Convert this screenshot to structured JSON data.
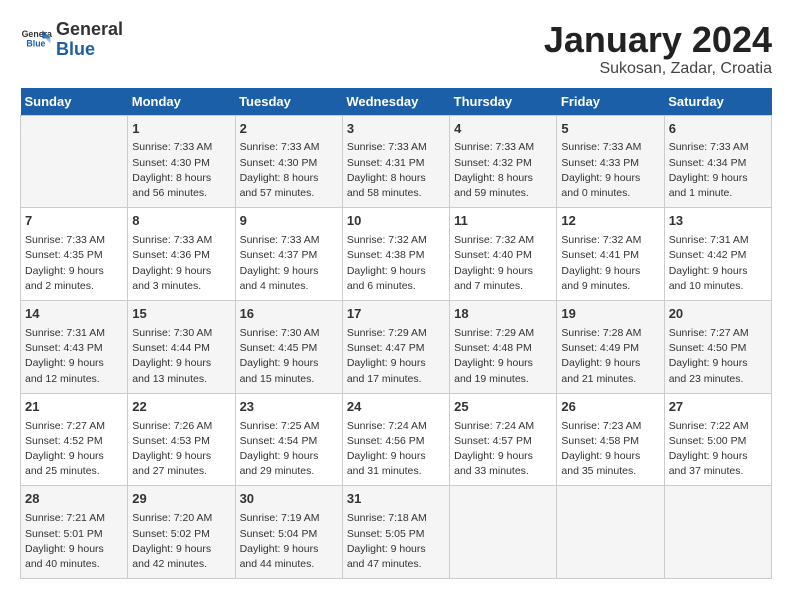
{
  "header": {
    "logo_general": "General",
    "logo_blue": "Blue",
    "month_year": "January 2024",
    "location": "Sukosan, Zadar, Croatia"
  },
  "days_of_week": [
    "Sunday",
    "Monday",
    "Tuesday",
    "Wednesday",
    "Thursday",
    "Friday",
    "Saturday"
  ],
  "weeks": [
    [
      {
        "day": "",
        "info": ""
      },
      {
        "day": "1",
        "info": "Sunrise: 7:33 AM\nSunset: 4:30 PM\nDaylight: 8 hours\nand 56 minutes."
      },
      {
        "day": "2",
        "info": "Sunrise: 7:33 AM\nSunset: 4:30 PM\nDaylight: 8 hours\nand 57 minutes."
      },
      {
        "day": "3",
        "info": "Sunrise: 7:33 AM\nSunset: 4:31 PM\nDaylight: 8 hours\nand 58 minutes."
      },
      {
        "day": "4",
        "info": "Sunrise: 7:33 AM\nSunset: 4:32 PM\nDaylight: 8 hours\nand 59 minutes."
      },
      {
        "day": "5",
        "info": "Sunrise: 7:33 AM\nSunset: 4:33 PM\nDaylight: 9 hours\nand 0 minutes."
      },
      {
        "day": "6",
        "info": "Sunrise: 7:33 AM\nSunset: 4:34 PM\nDaylight: 9 hours\nand 1 minute."
      }
    ],
    [
      {
        "day": "7",
        "info": "Sunrise: 7:33 AM\nSunset: 4:35 PM\nDaylight: 9 hours\nand 2 minutes."
      },
      {
        "day": "8",
        "info": "Sunrise: 7:33 AM\nSunset: 4:36 PM\nDaylight: 9 hours\nand 3 minutes."
      },
      {
        "day": "9",
        "info": "Sunrise: 7:33 AM\nSunset: 4:37 PM\nDaylight: 9 hours\nand 4 minutes."
      },
      {
        "day": "10",
        "info": "Sunrise: 7:32 AM\nSunset: 4:38 PM\nDaylight: 9 hours\nand 6 minutes."
      },
      {
        "day": "11",
        "info": "Sunrise: 7:32 AM\nSunset: 4:40 PM\nDaylight: 9 hours\nand 7 minutes."
      },
      {
        "day": "12",
        "info": "Sunrise: 7:32 AM\nSunset: 4:41 PM\nDaylight: 9 hours\nand 9 minutes."
      },
      {
        "day": "13",
        "info": "Sunrise: 7:31 AM\nSunset: 4:42 PM\nDaylight: 9 hours\nand 10 minutes."
      }
    ],
    [
      {
        "day": "14",
        "info": "Sunrise: 7:31 AM\nSunset: 4:43 PM\nDaylight: 9 hours\nand 12 minutes."
      },
      {
        "day": "15",
        "info": "Sunrise: 7:30 AM\nSunset: 4:44 PM\nDaylight: 9 hours\nand 13 minutes."
      },
      {
        "day": "16",
        "info": "Sunrise: 7:30 AM\nSunset: 4:45 PM\nDaylight: 9 hours\nand 15 minutes."
      },
      {
        "day": "17",
        "info": "Sunrise: 7:29 AM\nSunset: 4:47 PM\nDaylight: 9 hours\nand 17 minutes."
      },
      {
        "day": "18",
        "info": "Sunrise: 7:29 AM\nSunset: 4:48 PM\nDaylight: 9 hours\nand 19 minutes."
      },
      {
        "day": "19",
        "info": "Sunrise: 7:28 AM\nSunset: 4:49 PM\nDaylight: 9 hours\nand 21 minutes."
      },
      {
        "day": "20",
        "info": "Sunrise: 7:27 AM\nSunset: 4:50 PM\nDaylight: 9 hours\nand 23 minutes."
      }
    ],
    [
      {
        "day": "21",
        "info": "Sunrise: 7:27 AM\nSunset: 4:52 PM\nDaylight: 9 hours\nand 25 minutes."
      },
      {
        "day": "22",
        "info": "Sunrise: 7:26 AM\nSunset: 4:53 PM\nDaylight: 9 hours\nand 27 minutes."
      },
      {
        "day": "23",
        "info": "Sunrise: 7:25 AM\nSunset: 4:54 PM\nDaylight: 9 hours\nand 29 minutes."
      },
      {
        "day": "24",
        "info": "Sunrise: 7:24 AM\nSunset: 4:56 PM\nDaylight: 9 hours\nand 31 minutes."
      },
      {
        "day": "25",
        "info": "Sunrise: 7:24 AM\nSunset: 4:57 PM\nDaylight: 9 hours\nand 33 minutes."
      },
      {
        "day": "26",
        "info": "Sunrise: 7:23 AM\nSunset: 4:58 PM\nDaylight: 9 hours\nand 35 minutes."
      },
      {
        "day": "27",
        "info": "Sunrise: 7:22 AM\nSunset: 5:00 PM\nDaylight: 9 hours\nand 37 minutes."
      }
    ],
    [
      {
        "day": "28",
        "info": "Sunrise: 7:21 AM\nSunset: 5:01 PM\nDaylight: 9 hours\nand 40 minutes."
      },
      {
        "day": "29",
        "info": "Sunrise: 7:20 AM\nSunset: 5:02 PM\nDaylight: 9 hours\nand 42 minutes."
      },
      {
        "day": "30",
        "info": "Sunrise: 7:19 AM\nSunset: 5:04 PM\nDaylight: 9 hours\nand 44 minutes."
      },
      {
        "day": "31",
        "info": "Sunrise: 7:18 AM\nSunset: 5:05 PM\nDaylight: 9 hours\nand 47 minutes."
      },
      {
        "day": "",
        "info": ""
      },
      {
        "day": "",
        "info": ""
      },
      {
        "day": "",
        "info": ""
      }
    ]
  ]
}
